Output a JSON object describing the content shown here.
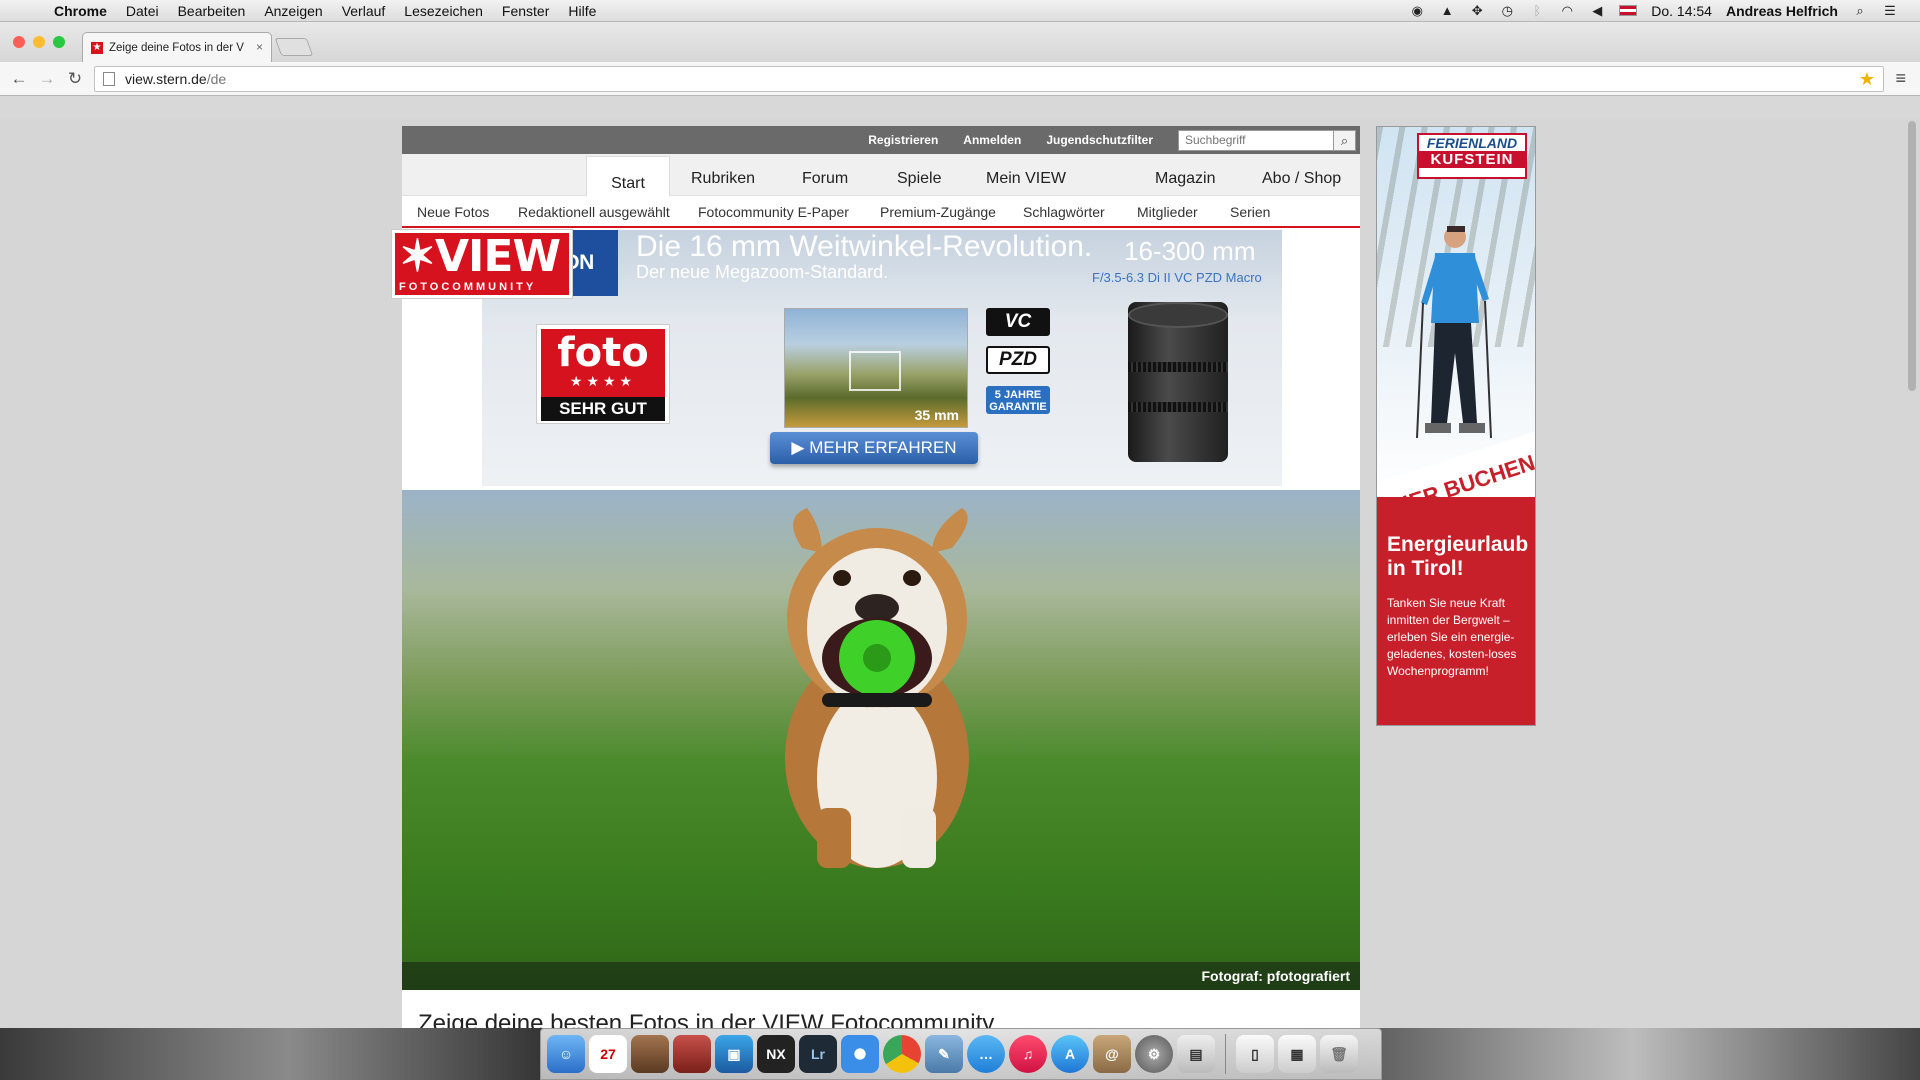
{
  "menubar": {
    "app": "Chrome",
    "items": [
      "Datei",
      "Bearbeiten",
      "Anzeigen",
      "Verlauf",
      "Lesezeichen",
      "Fenster",
      "Hilfe"
    ],
    "clock": "Do. 14:54",
    "user": "Andreas Helfrich"
  },
  "browser": {
    "tab_title": "Zeige deine Fotos in der V",
    "url_host": "view.stern.de",
    "url_path": "/de"
  },
  "site": {
    "logo": {
      "word": "VIEW",
      "sub": "FOTOCOMMUNITY"
    },
    "top_links": [
      "Registrieren",
      "Anmelden",
      "Jugendschutzfilter"
    ],
    "search_placeholder": "Suchbegriff",
    "main_nav": [
      "Start",
      "Rubriken",
      "Forum",
      "Spiele",
      "Mein VIEW",
      "Magazin",
      "Abo / Shop"
    ],
    "sub_nav": [
      "Neue Fotos",
      "Redaktionell ausgewählt",
      "Fotocommunity E-Paper",
      "Premium-Zugänge",
      "Schlagwörter",
      "Mitglieder",
      "Serien"
    ],
    "hero_caption": "Fotograf: pfotografiert",
    "page_title": "Zeige deine besten Fotos in der VIEW Fotocommunity"
  },
  "ad_tamron": {
    "brand": "TAMRON",
    "headline": "Die 16 mm Weitwinkel-Revolution.",
    "subline": "Der neue Megazoom-Standard.",
    "range": "16-300 mm",
    "model": "F/3.5-6.3 Di II VC PZD Macro",
    "foto_word": "foto",
    "foto_rating": "SEHR GUT",
    "photo_label": "35 mm",
    "cta": "MEHR ERFAHREN",
    "badge_vc": "VC",
    "badge_pzd": "PZD",
    "badge_guarantee": "5 JAHRE GARANTIE"
  },
  "ad_sky": {
    "brand_top": "FERIENLAND",
    "brand_bottom": "KUFSTEIN",
    "band": "HIER BUCHEN",
    "headline": "Energieurlaub in Tirol!",
    "text": "Tanken Sie neue Kraft inmitten der Bergwelt – erleben Sie ein energie-geladenes, kosten-loses Wochenprogramm!"
  },
  "dock": {
    "calendar_day": "27"
  }
}
